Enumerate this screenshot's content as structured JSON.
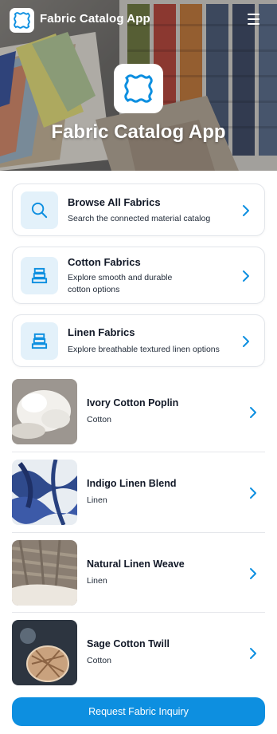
{
  "header": {
    "app_name": "Fabric Catalog App",
    "menu_icon": "hamburger-menu-icon",
    "logo_icon": "fabric-swatch-icon"
  },
  "hero": {
    "title": "Fabric Catalog App"
  },
  "categories": [
    {
      "title": "Browse All Fabrics",
      "subtitle": "Search the connected material catalog",
      "icon": "search-icon"
    },
    {
      "title": "Cotton Fabrics",
      "subtitle": "Explore smooth and durable cotton options",
      "icon": "fabric-stack-icon"
    },
    {
      "title": "Linen Fabrics",
      "subtitle": "Explore breathable textured linen options",
      "icon": "fabric-stack-icon"
    }
  ],
  "fabrics": [
    {
      "name": "Ivory Cotton Poplin",
      "type": "Cotton"
    },
    {
      "name": "Indigo Linen Blend",
      "type": "Linen"
    },
    {
      "name": "Natural Linen Weave",
      "type": "Linen"
    },
    {
      "name": "Sage Cotton Twill",
      "type": "Cotton"
    }
  ],
  "cta": {
    "label": "Request Fabric Inquiry"
  },
  "colors": {
    "accent": "#0d8fe0",
    "icon_bg": "#e3f1fa",
    "icon_stroke": "#0d8fe0"
  }
}
